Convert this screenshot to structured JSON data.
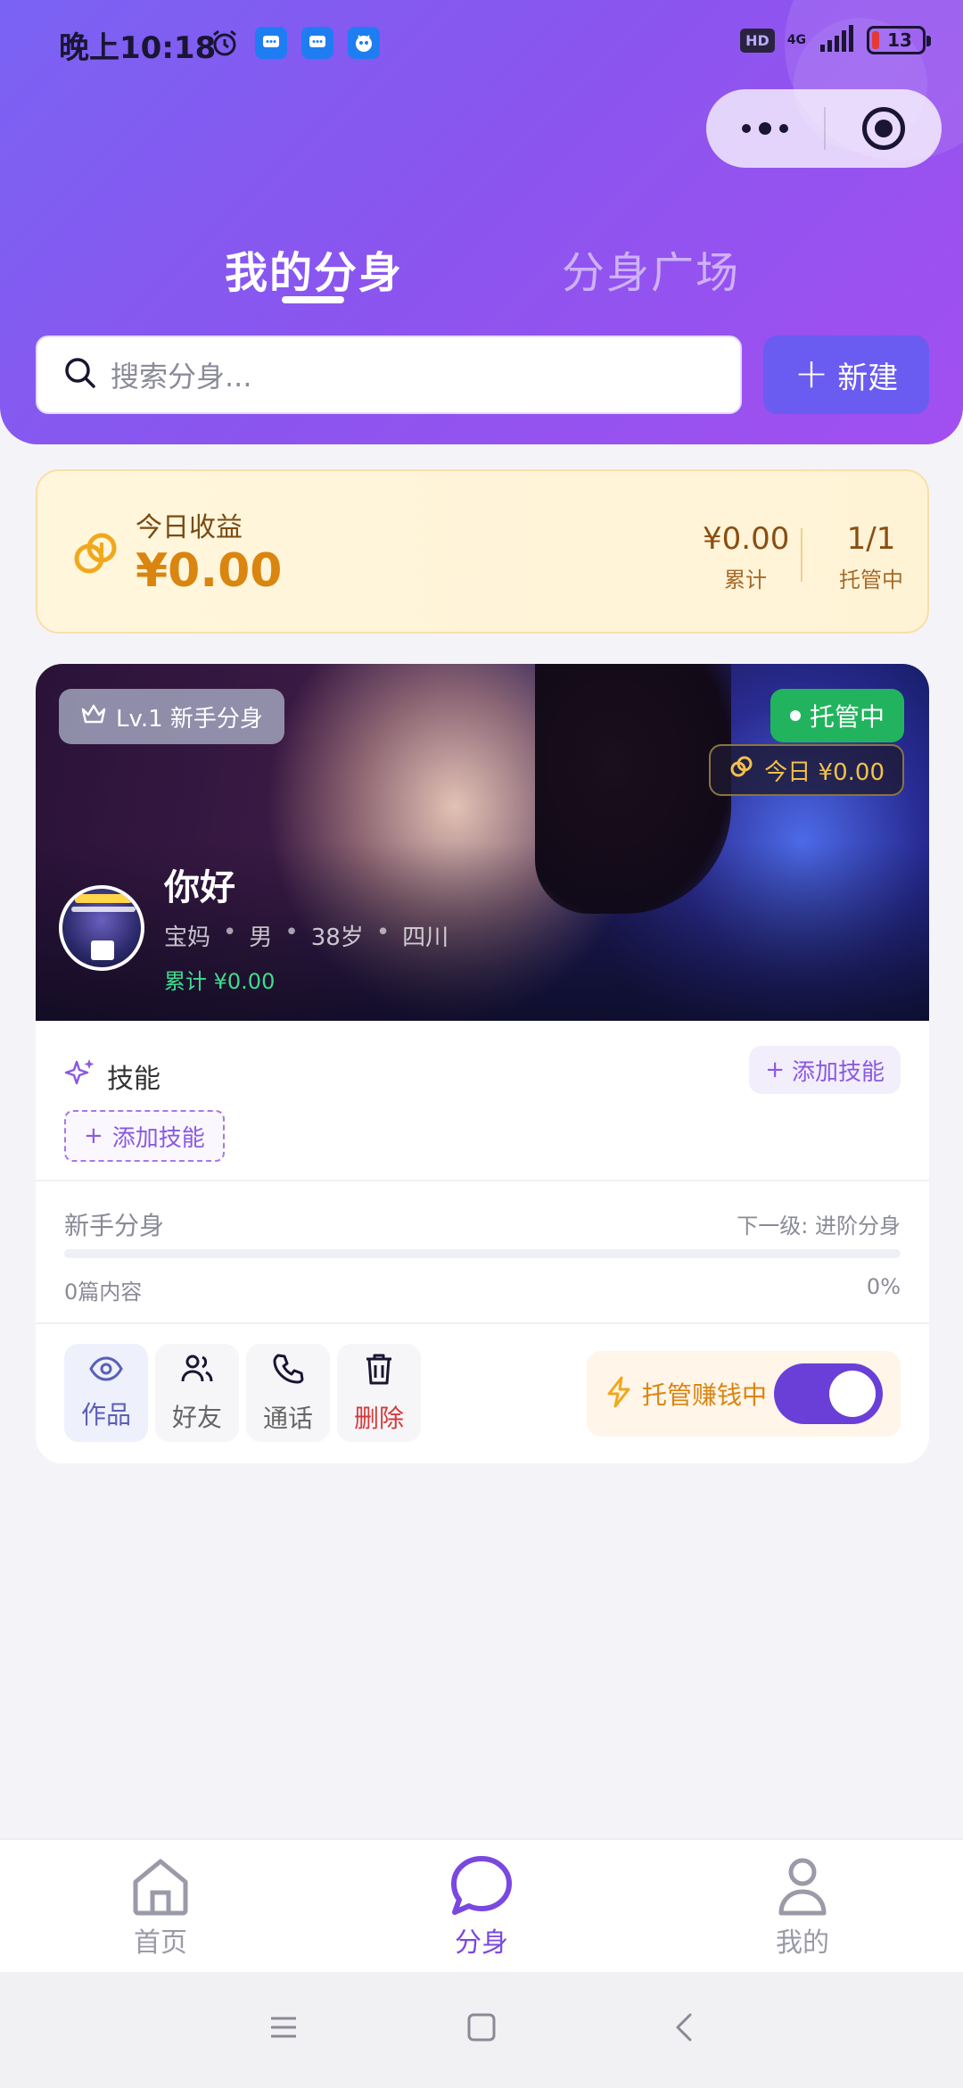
{
  "status": {
    "time": "晚上10:18",
    "hd": "HD",
    "network": "4G",
    "battery": "13"
  },
  "tabs": [
    {
      "label": "我的分身",
      "active": true
    },
    {
      "label": "分身广场",
      "active": false
    }
  ],
  "search": {
    "placeholder": "搜索分身..."
  },
  "new_button": {
    "label": "新建"
  },
  "earnings": {
    "label": "今日收益",
    "amount": "¥0.00",
    "total_value": "¥0.00",
    "total_label": "累计",
    "hosting_value": "1/1",
    "hosting_label": "托管中"
  },
  "clone": {
    "level_badge": "Lv.1 新手分身",
    "status": "托管中",
    "today": "今日 ¥0.00",
    "name": "你好",
    "meta": [
      "宝妈",
      "男",
      "38岁",
      "四川"
    ],
    "total": "累计 ¥0.00",
    "skills_title": "技能",
    "add_skill_small": "添加技能",
    "add_skill_dashed": "添加技能",
    "level_name": "新手分身",
    "next_level": "下一级: 进阶分身",
    "content_count": "0篇内容",
    "progress_percent": "0%",
    "progress": 0,
    "actions": [
      {
        "label": "作品",
        "icon": "eye-icon"
      },
      {
        "label": "好友",
        "icon": "users-icon"
      },
      {
        "label": "通话",
        "icon": "phone-icon"
      },
      {
        "label": "删除",
        "icon": "trash-icon"
      }
    ],
    "hosting_toggle_label": "托管赚钱中",
    "hosting_toggle_on": true
  },
  "bottom_nav": [
    {
      "label": "首页",
      "icon": "home-icon",
      "active": false
    },
    {
      "label": "分身",
      "icon": "chat-bubble-icon",
      "active": true
    },
    {
      "label": "我的",
      "icon": "user-icon",
      "active": false
    }
  ],
  "colors": {
    "brand": "#7a48e0",
    "header_gradient_start": "#7a63f4",
    "header_gradient_end": "#a24ff0",
    "earn_amount": "#d98510",
    "status_green": "#22b35e",
    "delete_red": "#d53a3a"
  }
}
